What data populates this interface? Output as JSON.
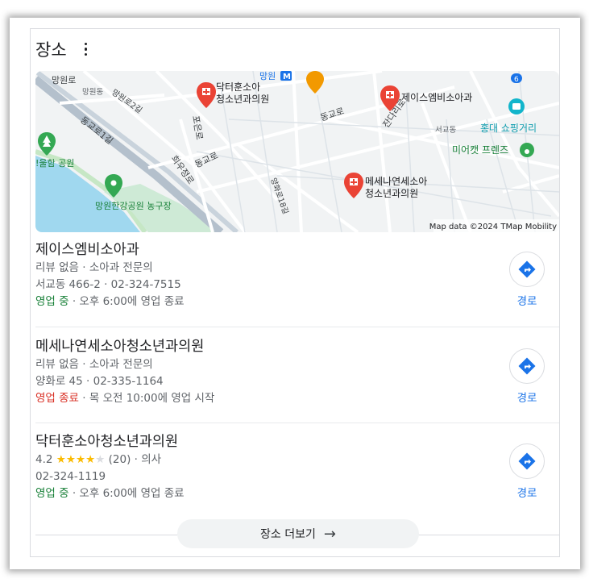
{
  "header": {
    "title": "장소"
  },
  "map": {
    "attribution": "Map data ©2024 TMap Mobility",
    "labels": {
      "mangwonro": "망원로",
      "mangwondong": "망원동",
      "mangwonro2gil": "망원로2길",
      "donggyoro1gil": "동교로1길",
      "pohangro": "포은로",
      "donggyoro_a": "동교로",
      "donggyoro_b": "동교로",
      "huiujeongro": "희우정로",
      "yanghwaro18gil": "양화로18길",
      "jandariro": "잔다리로",
      "seogyodong": "서교동",
      "olhamgongwon": "!울함 공원",
      "mangwon": "망원",
      "mangwon_park": "망원한강공원 농구장",
      "hongdae": "홍대 쇼핑거리",
      "miercat": "미어캣 프렌즈",
      "route6": "6",
      "metro": "M"
    },
    "pins": {
      "p1_line1": "닥터훈소아",
      "p1_line2": "청소년과의원",
      "p2": "제이스엠비소아과",
      "p3_line1": "메세나연세소아",
      "p3_line2": "청소년과의원"
    }
  },
  "results": [
    {
      "name": "제이스엠비소아과",
      "line1": "리뷰 없음 · 소아과 전문의",
      "line2": "서교동 466-2 · 02-324-7515",
      "status": "영업 중",
      "hours": " · 오후 6:00에 영업 종료",
      "route_label": "경로"
    },
    {
      "name": "메세나연세소아청소년과의원",
      "line1": "리뷰 없음 · 소아과 전문의",
      "line2": "양화로 45 · 02-335-1164",
      "status": "영업 종료",
      "hours": " · 목 오전 10:00에 영업 시작",
      "route_label": "경로"
    },
    {
      "name": "닥터훈소아청소년과의원",
      "rating": "4.2",
      "stars": 4,
      "review_count": "(20)",
      "category": " · 의사",
      "line2": "02-324-1119",
      "status": "영업 중",
      "hours": " · 오후 6:00에 영업 종료",
      "route_label": "경로"
    }
  ],
  "more_button": {
    "label": "장소 더보기"
  },
  "colors": {
    "open": "#188038",
    "closed": "#d93025",
    "link": "#1a73e8",
    "pin": "#ea4335"
  }
}
